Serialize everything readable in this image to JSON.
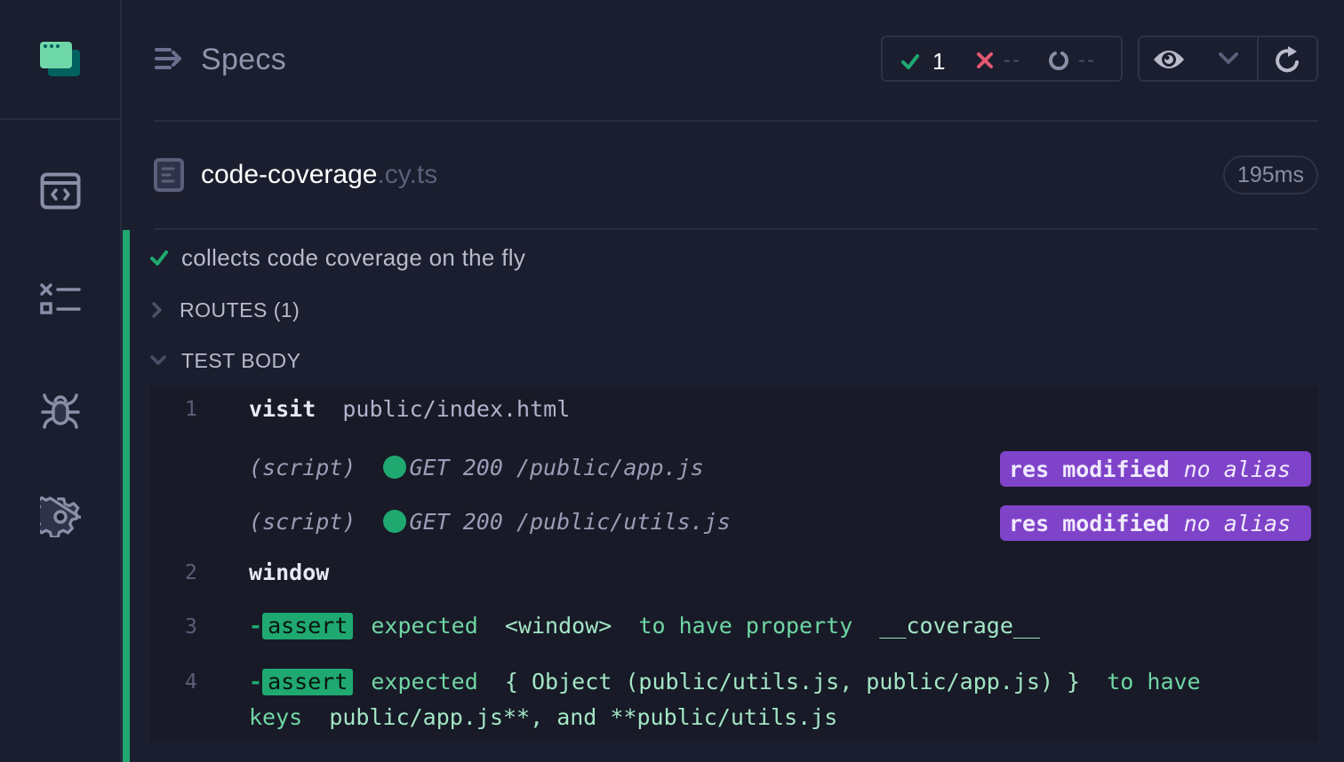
{
  "sidebar": {
    "logo": "cypress-app-logo",
    "items": [
      {
        "name": "specs",
        "icon": "code-window-icon"
      },
      {
        "name": "runs",
        "icon": "checklist-icon"
      },
      {
        "name": "debug",
        "icon": "bug-icon"
      },
      {
        "name": "settings",
        "icon": "gear-icon"
      }
    ]
  },
  "header": {
    "title": "Specs",
    "stats": {
      "passed": "1",
      "failed": "--",
      "pending": "--"
    },
    "controls": {
      "eye": "eye-icon",
      "dropdown": "chevron-down-icon",
      "refresh": "refresh-icon"
    }
  },
  "file": {
    "name": "code-coverage",
    "ext": ".cy.ts",
    "duration": "195ms"
  },
  "test": {
    "title": "collects code coverage on the fly",
    "status": "passed",
    "sections": {
      "routes": "ROUTES (1)",
      "body": "TEST BODY"
    },
    "commands": [
      {
        "num": "1",
        "name": "visit",
        "message": "public/index.html"
      },
      {
        "type": "(script)",
        "method_status": "GET 200",
        "url": "/public/app.js",
        "badge_bold": "res modified",
        "badge_italic": "no alias"
      },
      {
        "type": "(script)",
        "method_status": "GET 200",
        "url": "/public/utils.js",
        "badge_bold": "res modified",
        "badge_italic": "no alias"
      },
      {
        "num": "2",
        "name": "window"
      },
      {
        "num": "3",
        "dash": "-",
        "tag": "assert",
        "parts": [
          "expected",
          "<window>",
          "to have property",
          "__coverage__"
        ]
      },
      {
        "num": "4",
        "dash": "-",
        "tag": "assert",
        "parts": [
          "expected",
          "{ Object (public/utils.js, public/app.js) }",
          "to have",
          "keys",
          "public/app.js**, and **public/utils.js"
        ]
      }
    ]
  },
  "colors": {
    "pass": "#1fa971",
    "fail": "#e45770",
    "badge": "#7f43c9",
    "background": "#1b1e2e"
  }
}
